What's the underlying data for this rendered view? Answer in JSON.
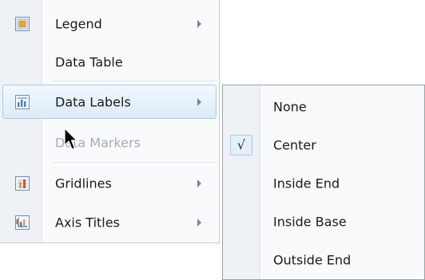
{
  "menu": {
    "items": [
      {
        "label": "Legend",
        "icon": "legend-icon",
        "has_submenu": true,
        "enabled": true
      },
      {
        "label": "Data Table",
        "icon": null,
        "has_submenu": false,
        "enabled": true
      },
      {
        "label": "Data Labels",
        "icon": "data-labels-icon",
        "has_submenu": true,
        "enabled": true,
        "highlighted": true
      },
      {
        "label": "Data Markers",
        "icon": null,
        "has_submenu": false,
        "enabled": false
      },
      {
        "label": "Gridlines",
        "icon": "gridlines-icon",
        "has_submenu": true,
        "enabled": true
      },
      {
        "label": "Axis Titles",
        "icon": "axis-titles-icon",
        "has_submenu": true,
        "enabled": true
      }
    ]
  },
  "submenu": {
    "items": [
      {
        "label": "None",
        "checked": false
      },
      {
        "label": "Center",
        "checked": true
      },
      {
        "label": "Inside End",
        "checked": false
      },
      {
        "label": "Inside Base",
        "checked": false
      },
      {
        "label": "Outside End",
        "checked": false
      }
    ],
    "check_glyph": "√"
  },
  "colors": {
    "highlight_border": "#a8cde9",
    "disabled_text": "#a6acb3"
  }
}
